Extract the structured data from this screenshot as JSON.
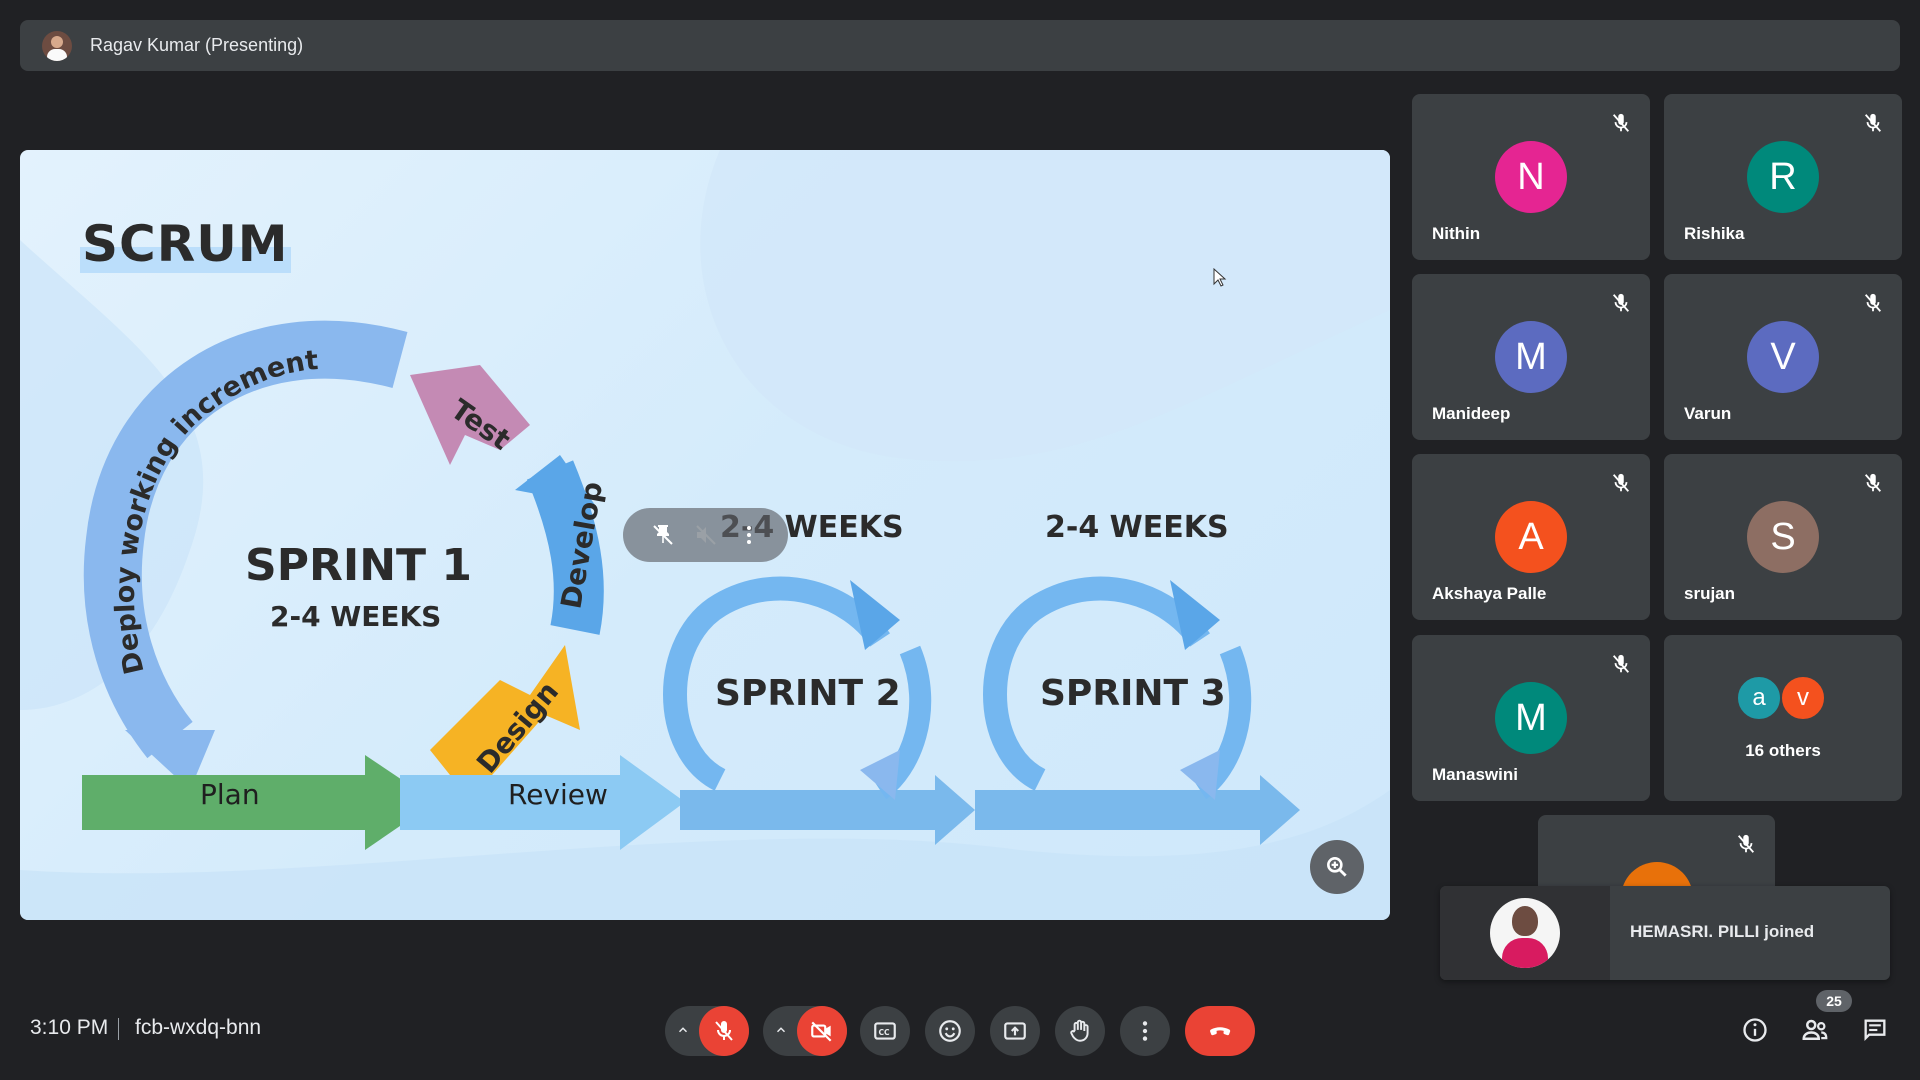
{
  "presenter_bar": {
    "title": "Ragav Kumar (Presenting)"
  },
  "slide": {
    "title": "SCRUM",
    "sprint1": "SPRINT 1",
    "sprint1_weeks": "2-4 WEEKS",
    "sprint2": "SPRINT 2",
    "sprint3": "SPRINT 3",
    "weeks2": "2-4 WEEKS",
    "weeks3": "2-4 WEEKS",
    "cycle_labels": {
      "deploy": "Deploy working increment",
      "test": "Test",
      "develop": "Develop",
      "design": "Design"
    },
    "plan": "Plan",
    "review": "Review"
  },
  "participants": [
    {
      "name": "Nithin",
      "initial": "N",
      "color": "#e52592"
    },
    {
      "name": "Rishika",
      "initial": "R",
      "color": "#00897b"
    },
    {
      "name": "Manideep",
      "initial": "M",
      "color": "#5c6bc0"
    },
    {
      "name": "Varun",
      "initial": "V",
      "color": "#5c6bc0"
    },
    {
      "name": "Akshaya Palle",
      "initial": "A",
      "color": "#f4511e"
    },
    {
      "name": "srujan",
      "initial": "S",
      "color": "#8d6e63"
    },
    {
      "name": "Manaswini",
      "initial": "M",
      "color": "#00897b"
    }
  ],
  "others_tile": {
    "label": "16 others",
    "avatars": [
      {
        "initial": "a",
        "color": "#1e9aa6"
      },
      {
        "initial": "v",
        "color": "#f4511e"
      }
    ]
  },
  "toast": {
    "message": "HEMASRI. PILLI joined"
  },
  "bottom": {
    "time": "3:10 PM",
    "meeting_code": "fcb-wxdq-bnn",
    "people_count": "25"
  },
  "colors": {
    "background": "#202124",
    "tile": "#3c4043",
    "danger": "#ea4335"
  },
  "icons": [
    "mic-off-icon",
    "camera-off-icon",
    "captions-icon",
    "emoji-icon",
    "present-icon",
    "raise-hand-icon",
    "more-icon",
    "end-call-icon",
    "info-icon",
    "people-icon",
    "chat-icon",
    "zoom-icon",
    "pin-icon"
  ]
}
